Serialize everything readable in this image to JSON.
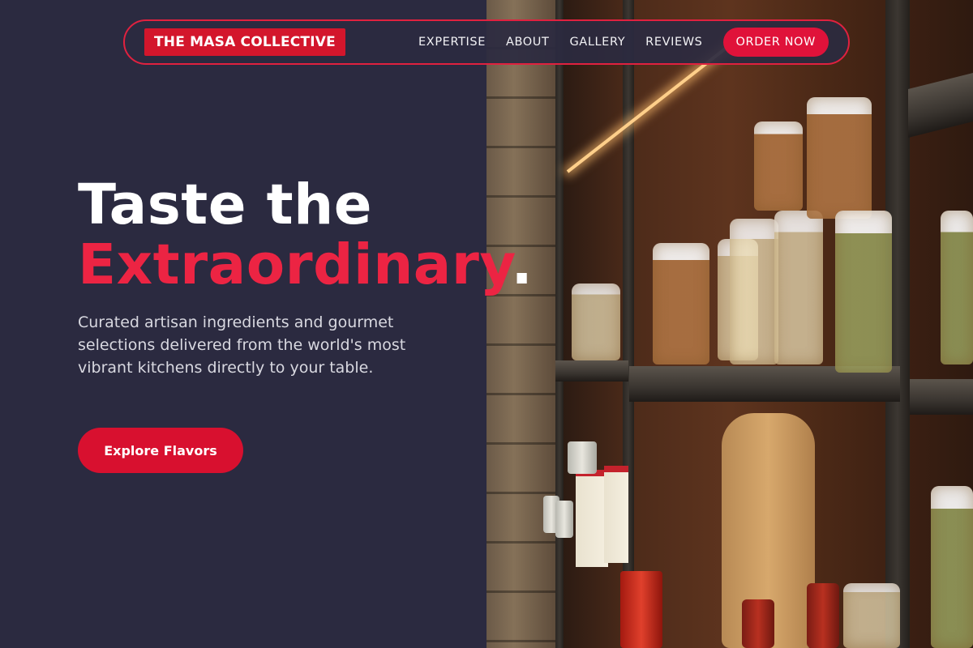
{
  "nav": {
    "brand": "THE MASA COLLECTIVE",
    "links": [
      "EXPERTISE",
      "ABOUT",
      "GALLERY",
      "REVIEWS"
    ],
    "order_label": "ORDER NOW"
  },
  "hero": {
    "title_line1": "Taste the",
    "title_accent": "Extraordinary",
    "title_dot": ".",
    "subtitle": "Curated artisan ingredients and gourmet selections delivered from the world's most vibrant kitchens directly to your table.",
    "cta_label": "Explore Flavors"
  },
  "colors": {
    "background": "#2b2a40",
    "accent": "#ec2443",
    "button": "#d8102f"
  },
  "images": {
    "hero_photo": "pantry-shelves-with-pasta-photo"
  }
}
